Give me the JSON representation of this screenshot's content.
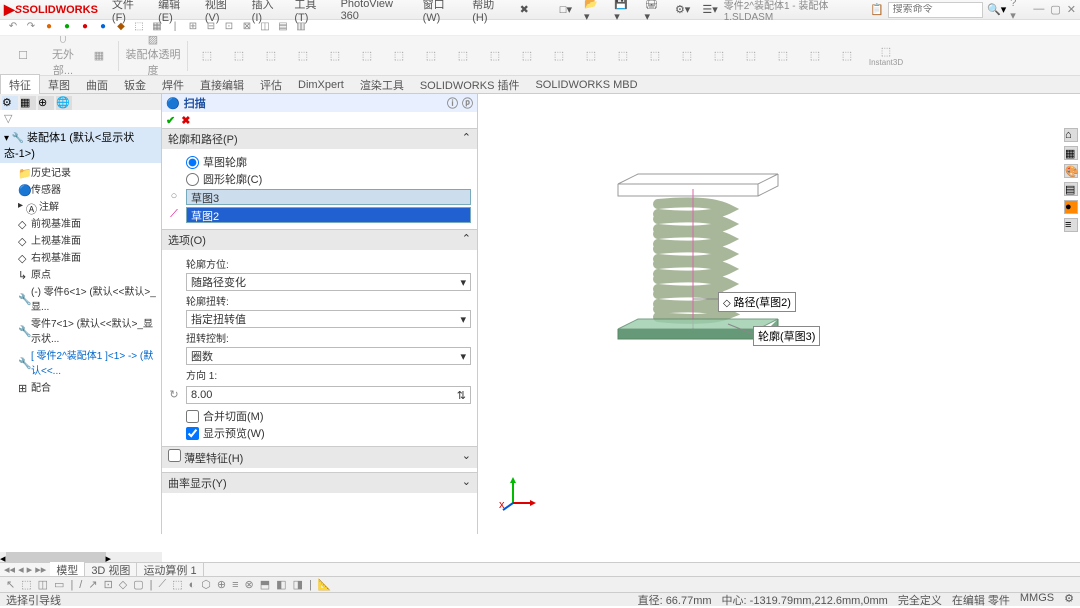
{
  "app": {
    "name": "SOLIDWORKS",
    "doc_title": "零件2^装配体1 - 装配体1.SLDASM"
  },
  "menu": {
    "items": [
      "文件(F)",
      "编辑(E)",
      "视图(V)",
      "插入(I)",
      "工具(T)",
      "PhotoView 360",
      "窗口(W)",
      "帮助(H)"
    ]
  },
  "search": {
    "placeholder": "搜索命令",
    "glass": "🔍"
  },
  "tabs": {
    "items": [
      "特征",
      "草图",
      "曲面",
      "钣金",
      "焊件",
      "直接编辑",
      "评估",
      "DimXpert",
      "渲染工具",
      "SOLIDWORKS 插件",
      "SOLIDWORKS MBD"
    ],
    "active": 0
  },
  "ribbon_text": {
    "a": "无外部...",
    "b": "装配体透明度"
  },
  "hud": {
    "items": [
      "🔍",
      "🔍",
      "◐",
      "🔲",
      "▦",
      "·",
      "●",
      "▾",
      "·",
      "⬚",
      "·",
      "▢",
      "·"
    ]
  },
  "tree": {
    "root": "装配体1 (默认<显示状态-1>)",
    "items": [
      {
        "ico": "📁",
        "label": "历史记录"
      },
      {
        "ico": "🔵",
        "label": "传感器"
      },
      {
        "ico": "Ⓐ",
        "label": "注解",
        "exp": "▸"
      },
      {
        "ico": "◇",
        "label": "前视基准面"
      },
      {
        "ico": "◇",
        "label": "上视基准面"
      },
      {
        "ico": "◇",
        "label": "右视基准面"
      },
      {
        "ico": "↳",
        "label": "原点"
      },
      {
        "ico": "🔧",
        "label": "(-) 零件6<1> (默认<<默认>_显..."
      },
      {
        "ico": "🔧",
        "label": "零件7<1> (默认<<默认>_显示状..."
      },
      {
        "ico": "🔧",
        "label": "[ 零件2^装配体1 ]<1> -> (默认<<...",
        "hl": true
      },
      {
        "ico": "⊞",
        "label": "配合"
      }
    ]
  },
  "prop": {
    "title": "扫描",
    "sections": {
      "profile_path": {
        "header": "轮廓和路径(P)",
        "radio1": "草图轮廓",
        "radio2": "圆形轮廓(C)",
        "field1": "草图3",
        "field2": "草图2"
      },
      "options": {
        "header": "选项(O)",
        "orient_label": "轮廓方位:",
        "orient_value": "随路径变化",
        "twist_label": "轮廓扭转:",
        "twist_value": "指定扭转值",
        "twistctl_label": "扭转控制:",
        "twistctl_value": "圈数",
        "dir_label": "方向 1:",
        "dir_value": "8.00",
        "merge": "合并切面(M)",
        "preview": "显示预览(W)"
      },
      "thin": {
        "header": "薄壁特征(H)"
      },
      "curv": {
        "header": "曲率显示(Y)"
      }
    }
  },
  "viewport": {
    "callout1": "路径(草图2)",
    "callout2": "轮廓(草图3)"
  },
  "bottom_tabs": {
    "items": [
      "模型",
      "3D 视图",
      "运动算例 1"
    ],
    "active": 0
  },
  "status": {
    "left": "选择引导线",
    "dist": "直径: 66.77mm",
    "center": "中心: -1319.79mm,212.6mm,0mm",
    "def": "完全定义",
    "mode": "在编辑 零件",
    "units": "MMGS"
  }
}
